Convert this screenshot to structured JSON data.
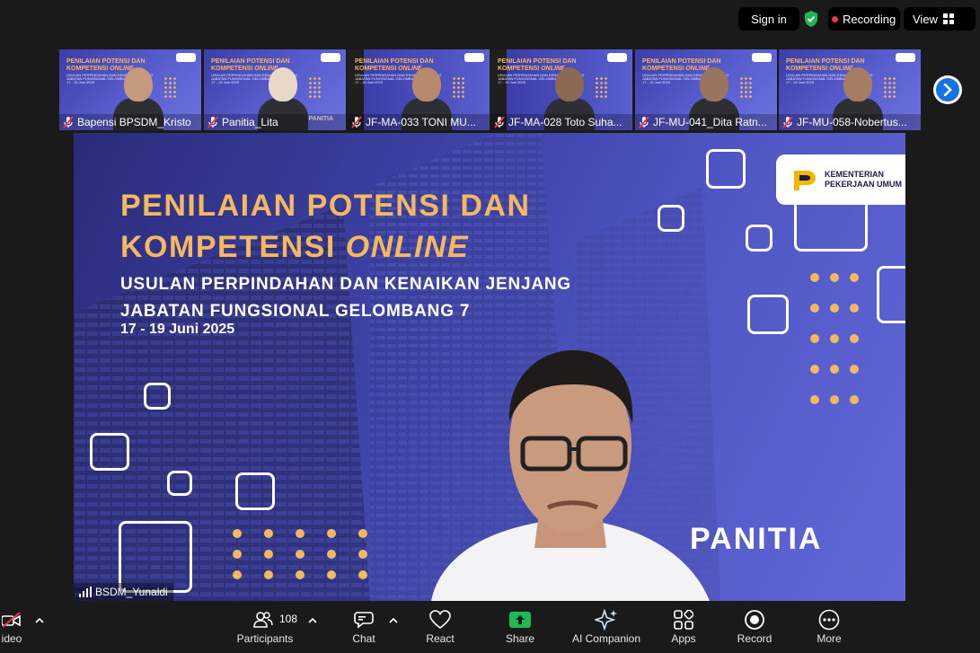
{
  "topbar": {
    "signin_label": "Sign in",
    "recording_label": "Recording",
    "view_label": "View",
    "shield_color": "#1db954",
    "recording_color": "#e8384f"
  },
  "thumb_slide": {
    "title_line1": "PENILAIAN POTENSI DAN",
    "title_line2a": "KOMPETENSI ",
    "title_line2b": "ONLINE",
    "subtitle": "USULAN PERPINDAHAN DAN KENAIKAN JENJANG JABATAN FUNGSIONAL GELOMBANG 7",
    "date": "17 - 19 Juni 2025",
    "tag": "PANITIA"
  },
  "participants": [
    {
      "name": "Bapensi BPSDM_Kristo"
    },
    {
      "name": "Panitia_Lita"
    },
    {
      "name": "JF-MA-033 TONI MU..."
    },
    {
      "name": "JF-MA-028 Toto Suha..."
    },
    {
      "name": "JF-MU-041_Dita Ratn..."
    },
    {
      "name": "JF-MU-058-Nobertus..."
    }
  ],
  "slide": {
    "title_line1": "PENILAIAN POTENSI DAN",
    "title_line2a": "KOMPETENSI ",
    "title_line2b": "ONLINE",
    "subtitle": "USULAN PERPINDAHAN DAN KENAIKAN JENJANG JABATAN FUNGSIONAL GELOMBANG 7",
    "date": "17 - 19 Juni 2025",
    "logo_text_line1": "KEMENTERIAN",
    "logo_text_line2": "PEKERJAAN UMUM",
    "panitia": "PANITIA",
    "accent_color": "#f4b860"
  },
  "speaker": {
    "name": "BSDM_Yunaldi"
  },
  "toolbar": {
    "video_label": "ideo",
    "participants_label": "Participants",
    "participants_count": "108",
    "chat_label": "Chat",
    "react_label": "React",
    "share_label": "Share",
    "share_color": "#1db954",
    "ai_label": "AI Companion",
    "apps_label": "Apps",
    "record_label": "Record",
    "more_label": "More"
  }
}
